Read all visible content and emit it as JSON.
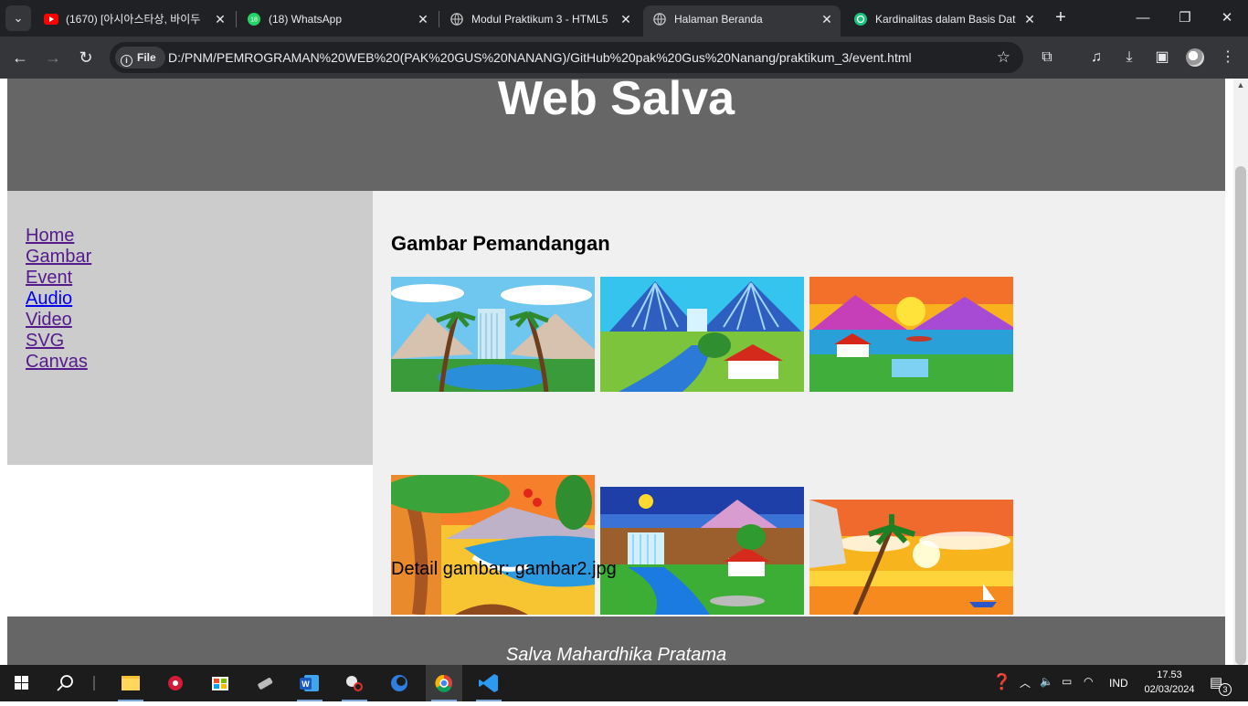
{
  "browser": {
    "tabs": [
      {
        "title": "(1670) [아시아스타상, 바이두",
        "icon": "youtube-icon",
        "active": false
      },
      {
        "title": "(18) WhatsApp",
        "icon": "whatsapp-icon",
        "active": false
      },
      {
        "title": "Modul Praktikum 3 - HTML5",
        "icon": "globe-icon",
        "active": false
      },
      {
        "title": "Halaman Beranda",
        "icon": "globe-icon",
        "active": true
      },
      {
        "title": "Kardinalitas dalam Basis Dat",
        "icon": "chatgpt-icon",
        "active": false
      }
    ],
    "address": {
      "scheme_chip": "File",
      "url": "D:/PNM/PEMROGRAMAN%20WEB%20(PAK%20GUS%20NANANG)/GitHub%20pak%20Gus%20Nanang/praktikum_3/event.html"
    }
  },
  "page": {
    "header_title": "Web Salva",
    "nav": [
      {
        "label": "Home",
        "visited": true
      },
      {
        "label": "Gambar",
        "visited": true
      },
      {
        "label": "Event",
        "visited": true
      },
      {
        "label": "Audio",
        "visited": false
      },
      {
        "label": "Video",
        "visited": true
      },
      {
        "label": "SVG",
        "visited": true
      },
      {
        "label": "Canvas",
        "visited": true
      }
    ],
    "section_title": "Gambar Pemandangan",
    "detail_text": "Detail gambar: gambar2.jpg",
    "footer_text": "Salva Mahardhika Pratama"
  },
  "taskbar": {
    "language": "IND",
    "time": "17.53",
    "date": "02/03/2024",
    "notification_count": "3"
  }
}
